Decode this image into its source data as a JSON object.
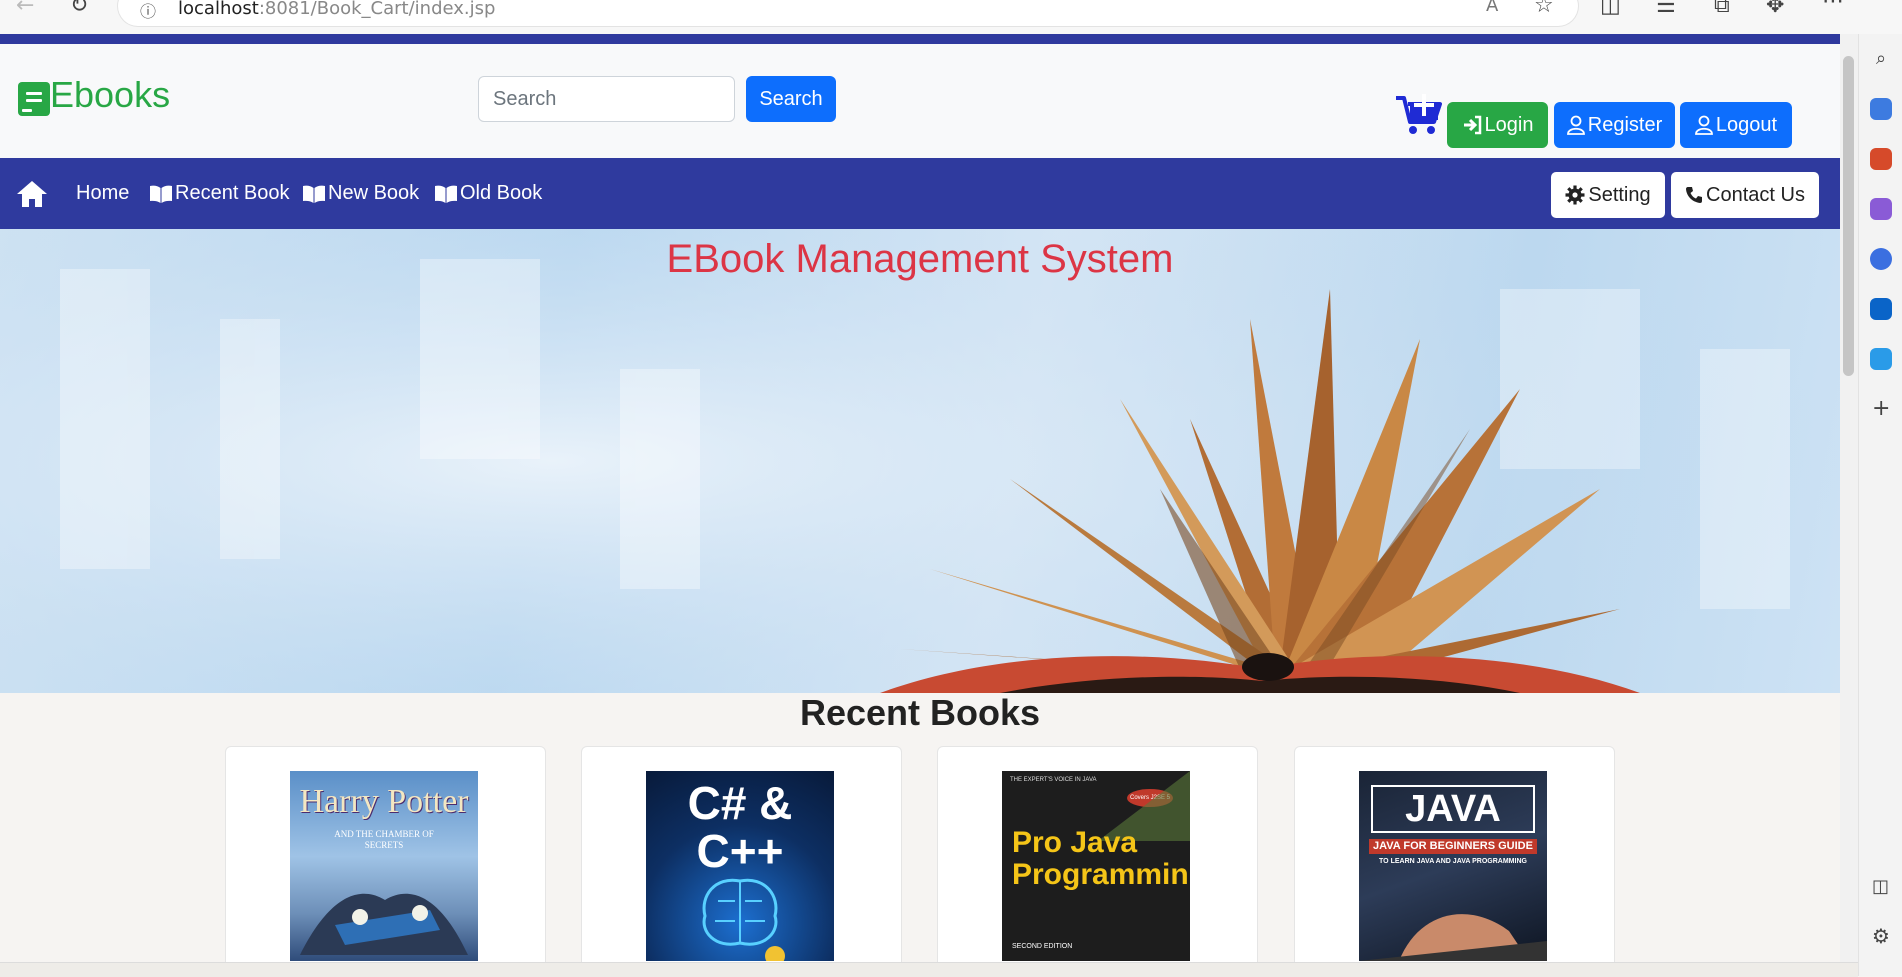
{
  "browser": {
    "url_host": "localhost",
    "url_rest": ":8081/Book_Cart/index.jsp"
  },
  "header": {
    "brand": "Ebooks",
    "search_placeholder": "Search",
    "search_button": "Search",
    "login": "Login",
    "register": "Register",
    "logout": "Logout"
  },
  "nav": {
    "home": "Home",
    "recent": "Recent Book",
    "new": "New Book",
    "old": "Old Book",
    "setting": "Setting",
    "contact": "Contact Us"
  },
  "hero": {
    "title": "EBook Management System"
  },
  "recent": {
    "title": "Recent Books",
    "books": [
      {
        "title": "Harry Potter",
        "subtitle": "AND THE CHAMBER OF SECRETS"
      },
      {
        "title": "C# & C++",
        "subtitle": ""
      },
      {
        "title": "Pro Java Programming",
        "subtitle": "SECOND EDITION",
        "tagline": "THE EXPERT'S VOICE IN JAVA",
        "badge": "Covers J2SE 5"
      },
      {
        "title": "JAVA",
        "subtitle": "JAVA FOR BEGINNERS GUIDE",
        "subtitle2": "TO LEARN JAVA AND JAVA PROGRAMMING"
      }
    ]
  },
  "colors": {
    "brand_green": "#28a745",
    "primary_blue": "#0d6efd",
    "navbar": "#2f3a9e",
    "hero_title": "#dc3545"
  }
}
